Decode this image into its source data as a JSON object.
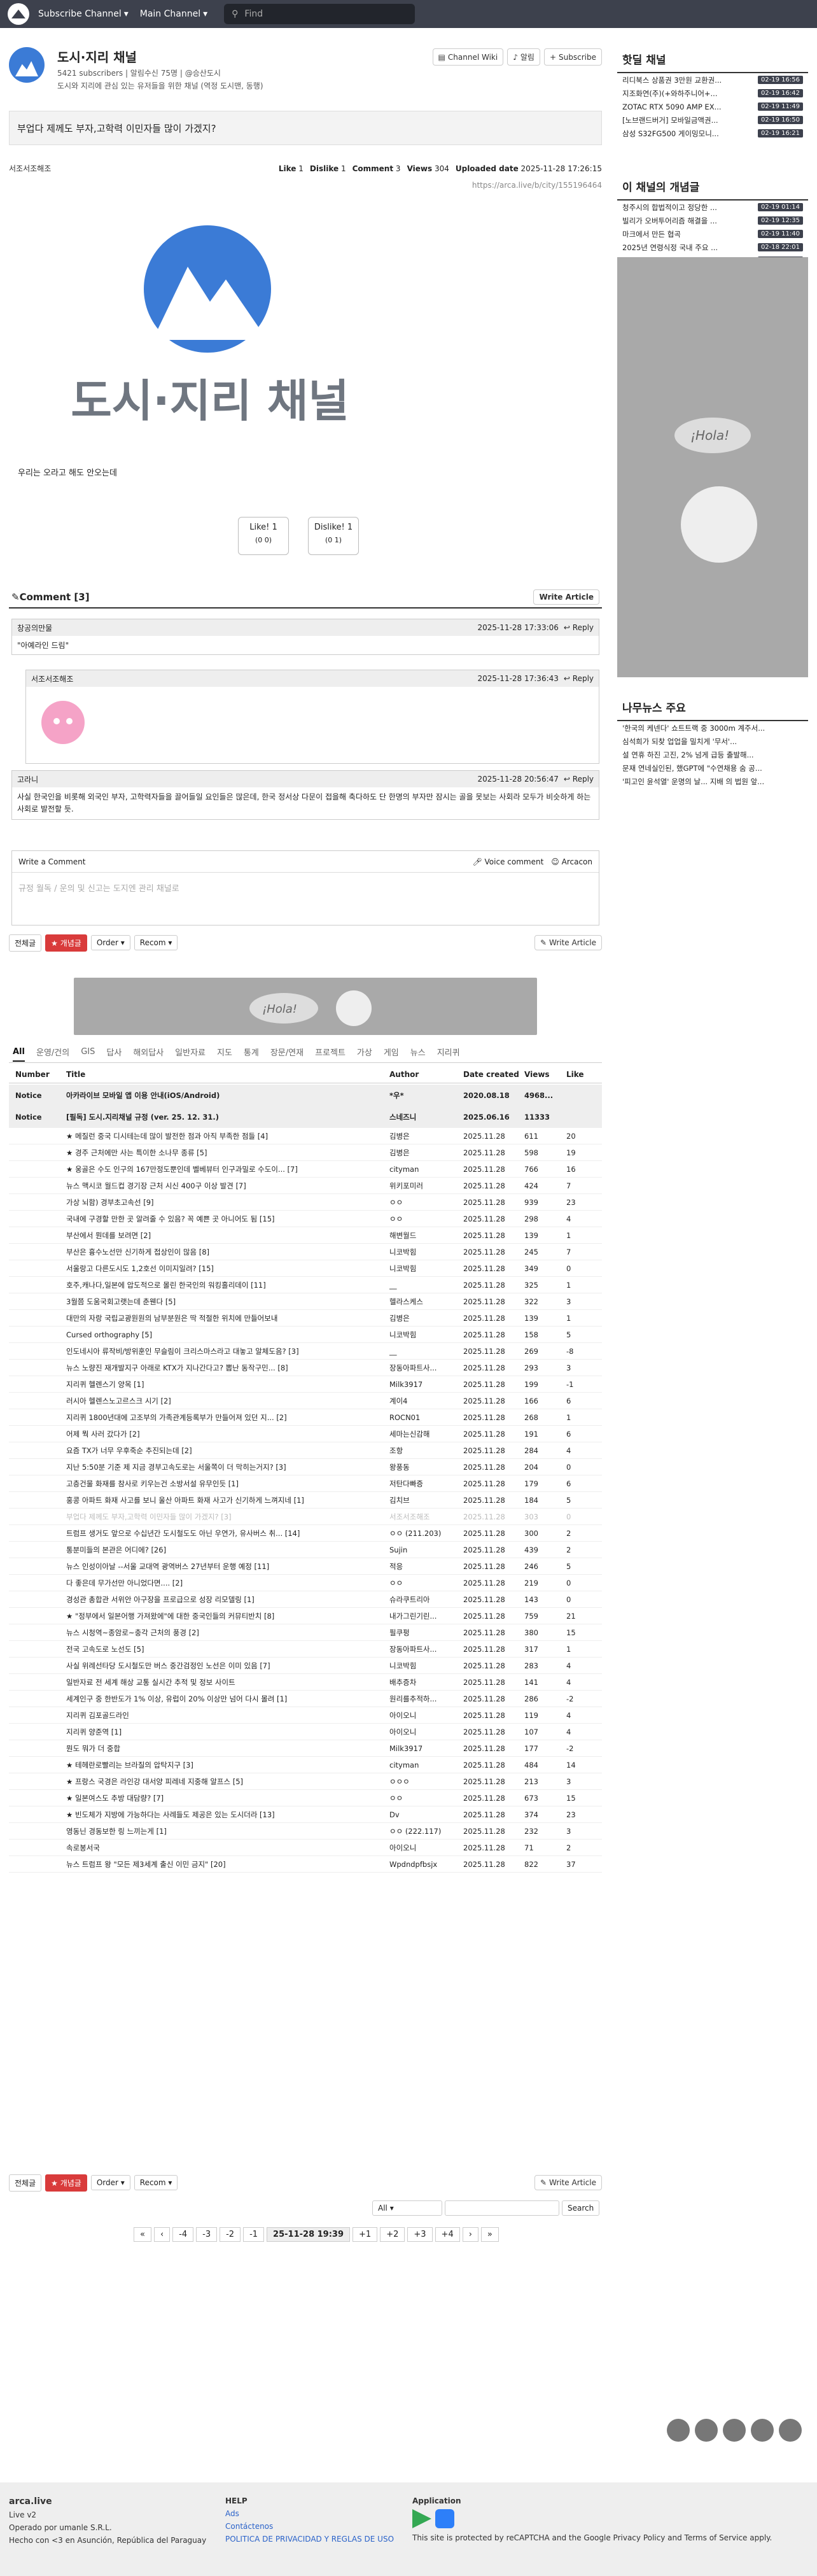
{
  "nav": {
    "subscribe": "Subscribe Channel",
    "main": "Main Channel",
    "search_placeholder": "Find"
  },
  "channel": {
    "title": "도시·지리 채널",
    "sub": "5421 subscribers | 알림수신 75명 | @승산도시",
    "desc": "도시와 지리에 관심 있는 유저들을 위한 채널 (역정 도시맨, 동행)",
    "wiki": "Channel Wiki",
    "alarm": "알림",
    "subscribe": "Subscribe"
  },
  "article": {
    "title": "부업다 제께도 부자,고학력 이민자들 많이 가겠지?",
    "author": "서조서조해조",
    "like_label": "Like",
    "like": "1",
    "dislike_label": "Dislike",
    "dislike": "1",
    "comment_label": "Comment",
    "comment": "3",
    "views_label": "Views",
    "views": "304",
    "upload_label": "Uploaded date",
    "upload": "2025-11-28 17:26:15",
    "url": "https://arca.live/b/city/155196464",
    "body": "우리는 오라고 해도 안오는데",
    "banner_text": "도시·지리 채널",
    "like_btn": "Like!",
    "like_btn_cnt": "1",
    "like_btn_sub": "(0 0)",
    "dislike_btn": "Dislike!",
    "dislike_btn_cnt": "1",
    "dislike_btn_sub": "(0 1)"
  },
  "comments": {
    "header": "Comment [3]",
    "write": "Write Article",
    "reply": "Reply",
    "items": [
      {
        "author": "창공의만물",
        "time": "2025-11-28 17:33:06",
        "text": "\"아예라인 드림\""
      },
      {
        "author": "서조서조해조",
        "time": "2025-11-28 17:36:43",
        "text": ""
      },
      {
        "author": "고라니",
        "time": "2025-11-28 20:56:47",
        "text": "사실 한국인을 비롯해 외국인 부자, 고학력자들을 끌어들일 요인들은 많은데, 한국 정서상 다문이 접을해 축다하도 단 한명의 부자만 잠시는 골을 못보는 사회라 모두가 비슷하게 하는 사회로 발전할 듯."
      }
    ]
  },
  "editor": {
    "label": "Write a Comment",
    "voice": "Voice comment",
    "arcacon": "Arcacon",
    "placeholder": "규정 월독 / 운의 및 신고는 도지엔 관리 채널로"
  },
  "filter": {
    "all": "전체글",
    "best": "개념글",
    "order": "Order",
    "recom": "Recom",
    "write": "Write Article"
  },
  "cats": [
    "All",
    "운영/건의",
    "GIS",
    "답사",
    "해외답사",
    "일반자료",
    "지도",
    "통계",
    "장문/연재",
    "프로젝트",
    "가상",
    "게임",
    "뉴스",
    "지리퀴"
  ],
  "thead": {
    "num": "Number",
    "title": "Title",
    "author": "Author",
    "date": "Date created",
    "views": "Views",
    "like": "Like"
  },
  "rows": [
    {
      "num": "Notice",
      "title": "아카라이브 모바일 앱 이용 안내(iOS/Android)",
      "author": "*우*",
      "date": "2020.08.18",
      "views": "4968...",
      "like": "",
      "cls": "notice"
    },
    {
      "num": "Notice",
      "title": "[필독] 도시.지리채널 규정 (ver. 25. 12. 31.)",
      "author": "스네즈니",
      "date": "2025.06.16",
      "views": "11333",
      "like": "",
      "cls": "notice"
    },
    {
      "num": "",
      "title": "★ 메질런 중국 디시테는데 많이 발전한 점과 아직 부족한 점들 [4]",
      "author": "김병은",
      "date": "2025.11.28",
      "views": "611",
      "like": "20",
      "cls": ""
    },
    {
      "num": "",
      "title": "★ 경주 근처에만 사는 특이한 소나무 종류 [5]",
      "author": "김병은",
      "date": "2025.11.28",
      "views": "598",
      "like": "19",
      "cls": ""
    },
    {
      "num": "",
      "title": "★ 웅골은 수도 인구의 167만정도뿐인데 벨베뷰터 인구과밀로 수도이... [7]",
      "author": "cityman",
      "date": "2025.11.28",
      "views": "766",
      "like": "16",
      "cls": ""
    },
    {
      "num": "",
      "title": "뉴스 맥시코 월드컵 경기장 근처 시신 400구 이상 발견 [7]",
      "author": "위키포미러",
      "date": "2025.11.28",
      "views": "424",
      "like": "7",
      "cls": ""
    },
    {
      "num": "",
      "title": "가상 뇌함) 경부초고속선 [9]",
      "author": "ㅇㅇ",
      "date": "2025.11.28",
      "views": "939",
      "like": "23",
      "cls": ""
    },
    {
      "num": "",
      "title": "국내에 구경할 만한 곳 알려줄 수 있음? 꼭 예쁜 곳 아니어도 됨 [15]",
      "author": "ㅇㅇ",
      "date": "2025.11.28",
      "views": "298",
      "like": "4",
      "cls": ""
    },
    {
      "num": "",
      "title": "부산에서 뭔데를 보려면 [2]",
      "author": "해변월드",
      "date": "2025.11.28",
      "views": "139",
      "like": "1",
      "cls": ""
    },
    {
      "num": "",
      "title": "부산은 흉수노선만 신기하게 접상인이 많음 [8]",
      "author": "니코박힘",
      "date": "2025.11.28",
      "views": "245",
      "like": "7",
      "cls": ""
    },
    {
      "num": "",
      "title": "서울랑고 다른도시도 1,2호선 이미지일려? [15]",
      "author": "니코박힘",
      "date": "2025.11.28",
      "views": "349",
      "like": "0",
      "cls": ""
    },
    {
      "num": "",
      "title": "호주,캐나다,일본에 압도적으로 몰린 한국인의 워킹홀리데이 [11]",
      "author": "__",
      "date": "2025.11.28",
      "views": "325",
      "like": "1",
      "cls": ""
    },
    {
      "num": "",
      "title": "3월쯤 도움국회고랫는데 춘웬다 [5]",
      "author": "헬라스케스",
      "date": "2025.11.28",
      "views": "322",
      "like": "3",
      "cls": ""
    },
    {
      "num": "",
      "title": "대만의 자랑 국립교광원원의 남부분원은 딱 적절한 위치에 만들어보내",
      "author": "김병은",
      "date": "2025.11.28",
      "views": "139",
      "like": "1",
      "cls": ""
    },
    {
      "num": "",
      "title": "Cursed orthography [5]",
      "author": "니코박힘",
      "date": "2025.11.28",
      "views": "158",
      "like": "5",
      "cls": ""
    },
    {
      "num": "",
      "title": "인도네시아 류작비/방위훈인 무슬림이 크리스마스라고 대놓고 알체도음? [3]",
      "author": "__",
      "date": "2025.11.28",
      "views": "269",
      "like": "-8",
      "cls": ""
    },
    {
      "num": "",
      "title": "뉴스 노량진 재개발지구 아래로 KTX가 지나간다고? 뽑난 동작구민... [8]",
      "author": "장동아파트사...",
      "date": "2025.11.28",
      "views": "293",
      "like": "3",
      "cls": ""
    },
    {
      "num": "",
      "title": "지리퀴 헬렌스기 양목 [1]",
      "author": "Milk3917",
      "date": "2025.11.28",
      "views": "199",
      "like": "-1",
      "cls": ""
    },
    {
      "num": "",
      "title": "러시아 헬렌스노고르스크 시기 [2]",
      "author": "계이4",
      "date": "2025.11.28",
      "views": "166",
      "like": "6",
      "cls": ""
    },
    {
      "num": "",
      "title": "지리퀴 1800년대에 고조부의 가족관계등록부가 만들어져 있던 지... [2]",
      "author": "ROCN01",
      "date": "2025.11.28",
      "views": "268",
      "like": "1",
      "cls": ""
    },
    {
      "num": "",
      "title": "어제 뭑 사러 갔다가 [2]",
      "author": "세마는신감해",
      "date": "2025.11.28",
      "views": "191",
      "like": "6",
      "cls": ""
    },
    {
      "num": "",
      "title": "요즘 TX가 너무 우후죽순 추진되는데 [2]",
      "author": "조항",
      "date": "2025.11.28",
      "views": "284",
      "like": "4",
      "cls": ""
    },
    {
      "num": "",
      "title": "지난 5:50분 기준 제 지금 경부고속도로는 서울쪽이 더 막히는거지? [3]",
      "author": "왕풍동",
      "date": "2025.11.28",
      "views": "204",
      "like": "0",
      "cls": ""
    },
    {
      "num": "",
      "title": "고층건물 화재를 참사로 키우는건 소방서설 유무인듯 [1]",
      "author": "저탄다빠증",
      "date": "2025.11.28",
      "views": "179",
      "like": "6",
      "cls": ""
    },
    {
      "num": "",
      "title": "홍콩 아파트 화재 사고를 보니 울산 아파트 화재 사고가 신기하게 느껴지네 [1]",
      "author": "김치브",
      "date": "2025.11.28",
      "views": "184",
      "like": "5",
      "cls": ""
    },
    {
      "num": "",
      "title": "부업다 제께도 부자,고학력 이민자들 많이 가겠지? [3]",
      "author": "서조서조해조",
      "date": "2025.11.28",
      "views": "303",
      "like": "0",
      "cls": "dim"
    },
    {
      "num": "",
      "title": "트럼프 생거도 앞으로 수십년간 도시철도도 아닌 우연가, 유사버스 취... [14]",
      "author": "ㅇㅇ (211.203)",
      "date": "2025.11.28",
      "views": "300",
      "like": "2",
      "cls": ""
    },
    {
      "num": "",
      "title": "통분미들의 본관은 어디에? [26]",
      "author": "Sujin",
      "date": "2025.11.28",
      "views": "439",
      "like": "2",
      "cls": ""
    },
    {
      "num": "",
      "title": "뉴스 인성이아날 --서울 교대역 광역버스 27년부터 운행 예정 [11]",
      "author": "적응",
      "date": "2025.11.28",
      "views": "246",
      "like": "5",
      "cls": ""
    },
    {
      "num": "",
      "title": "다 좋은데 무가선만 아니었다면.... [2]",
      "author": "ㅇㅇ",
      "date": "2025.11.28",
      "views": "219",
      "like": "0",
      "cls": ""
    },
    {
      "num": "",
      "title": "경성관 총합관 서위안 아구장을 프로급으로 성장 리모델링 [1]",
      "author": "슈라쿠트리아",
      "date": "2025.11.28",
      "views": "143",
      "like": "0",
      "cls": ""
    },
    {
      "num": "",
      "title": "★ \"정부에서 일본어행 가져왔에\"에 대한 중국인들의 커뮤티반치 [8]",
      "author": "내가그린기린...",
      "date": "2025.11.28",
      "views": "759",
      "like": "21",
      "cls": ""
    },
    {
      "num": "",
      "title": "뉴스 시청역~종암로~충각 근처의 풍경 [2]",
      "author": "필쿠펑",
      "date": "2025.11.28",
      "views": "380",
      "like": "15",
      "cls": ""
    },
    {
      "num": "",
      "title": "전국 고속도로 노선도 [5]",
      "author": "장동아파트사...",
      "date": "2025.11.28",
      "views": "317",
      "like": "1",
      "cls": ""
    },
    {
      "num": "",
      "title": "사실 위례선타당 도시철도만 버스 중간검정인 노선은 이미 있음 [7]",
      "author": "니코박힘",
      "date": "2025.11.28",
      "views": "283",
      "like": "4",
      "cls": ""
    },
    {
      "num": "",
      "title": "일반자료 전 세계 해상 교통 실시간 추적 및 정보 사이트",
      "author": "배추증차",
      "date": "2025.11.28",
      "views": "141",
      "like": "4",
      "cls": ""
    },
    {
      "num": "",
      "title": "세계인구 중 한반도가 1% 이상, 유럽이 20% 이상만 넘어 다시 몰려 [1]",
      "author": "원리를추적하...",
      "date": "2025.11.28",
      "views": "286",
      "like": "-2",
      "cls": ""
    },
    {
      "num": "",
      "title": "지리퀴 김포골드라인",
      "author": "아이오니",
      "date": "2025.11.28",
      "views": "119",
      "like": "4",
      "cls": ""
    },
    {
      "num": "",
      "title": "지리퀴 양준역 [1]",
      "author": "아이오니",
      "date": "2025.11.28",
      "views": "107",
      "like": "4",
      "cls": ""
    },
    {
      "num": "",
      "title": "뭔도 뭐가 더 중합",
      "author": "Milk3917",
      "date": "2025.11.28",
      "views": "177",
      "like": "-2",
      "cls": ""
    },
    {
      "num": "",
      "title": "★ 테헤란로빨리는 브라질의 압탁지구 [3]",
      "author": "cityman",
      "date": "2025.11.28",
      "views": "484",
      "like": "14",
      "cls": ""
    },
    {
      "num": "",
      "title": "★ 프랑스 국경은 라인강 대서양 피레네 지중해 알프스 [5]",
      "author": "ㅇㅇㅇ",
      "date": "2025.11.28",
      "views": "213",
      "like": "3",
      "cls": ""
    },
    {
      "num": "",
      "title": "★ 일본여스도 추방 대담량? [7]",
      "author": "ㅇㅇ",
      "date": "2025.11.28",
      "views": "673",
      "like": "15",
      "cls": ""
    },
    {
      "num": "",
      "title": "★ 빈도체가 지방에 가능하다는 사례들도 제공은 있는 도시더라 [13]",
      "author": "Dv",
      "date": "2025.11.28",
      "views": "374",
      "like": "23",
      "cls": ""
    },
    {
      "num": "",
      "title": "영동닌 경동보한 링 느끼는게 [1]",
      "author": "ㅇㅇ (222.117)",
      "date": "2025.11.28",
      "views": "232",
      "like": "3",
      "cls": ""
    },
    {
      "num": "",
      "title": "속로봉서국",
      "author": "아이오니",
      "date": "2025.11.28",
      "views": "71",
      "like": "2",
      "cls": ""
    },
    {
      "num": "",
      "title": "뉴스 트럼프 왕 \"모든 제3세계 출신 이민 금지\" [20]",
      "author": "Wpdndpfbsjx",
      "date": "2025.11.28",
      "views": "822",
      "like": "37",
      "cls": ""
    }
  ],
  "pager": [
    "«",
    "‹",
    "-4",
    "-3",
    "-2",
    "-1",
    "25-11-28 19:39",
    "+1",
    "+2",
    "+3",
    "+4",
    "›",
    "»"
  ],
  "search2": {
    "scope": "All",
    "btn": "Search"
  },
  "sidebar": {
    "hot_title": "핫딜 채널",
    "hot": [
      {
        "t": "리디북스 상품권 3만원 교환권...",
        "d": "02-19 16:56"
      },
      {
        "t": "지조화연(주)(+와하주니어+...",
        "d": "02-19 16:42"
      },
      {
        "t": "ZOTAC RTX 5090 AMP EX...",
        "d": "02-19 11:49"
      },
      {
        "t": "[노브랜드버거] 모바일금액권...",
        "d": "02-19 16:50"
      },
      {
        "t": "삼성 S32FG500 게이밍모니...",
        "d": "02-19 16:21"
      }
    ],
    "best_title": "이 채널의 개념글",
    "best": [
      {
        "t": "청주시의 합법적이고 정당한 ...",
        "d": "02-19 01:14"
      },
      {
        "t": "빌리가 오버투어리즘 해결을 ...",
        "d": "02-19 12:35"
      },
      {
        "t": "마크에서 만든 협곡",
        "d": "02-19 11:40"
      },
      {
        "t": "2025년 연령식정 국내 주요 ...",
        "d": "02-18 22:01"
      },
      {
        "t": "스팀)진짜 정읍에 위치한 정읍역",
        "d": "02-18 23:35"
      }
    ],
    "news_title": "나무뉴스 주요",
    "news": [
      "'한국의 케넨다' 쇼트트랙 중 3000m 계주서...",
      "심석희가 되찾 업업을 밀치게 '무서'...",
      "설 연휴 하진 고진, 2% 넘게 급등 출발해...",
      "문재 연네실인된, 했GPT에 \"수연채용 숨 공...",
      "'피고인 윤석열' 운명의 날... 지배 의 법원 앞..."
    ]
  },
  "footer": {
    "site": "arca.live",
    "ver": "Live v2",
    "op": "Operado por umanle S.R.L.",
    "made": "Hecho con <3 en Asunción, República del Paraguay",
    "help": "HELP",
    "ads": "Ads",
    "contact": "Contáctenos",
    "privacy": "POLITICA DE PRIVACIDAD Y REGLAS DE USO",
    "app": "Application",
    "recaptcha": "This site is protected by reCAPTCHA and the Google Privacy Policy and Terms of Service apply."
  }
}
